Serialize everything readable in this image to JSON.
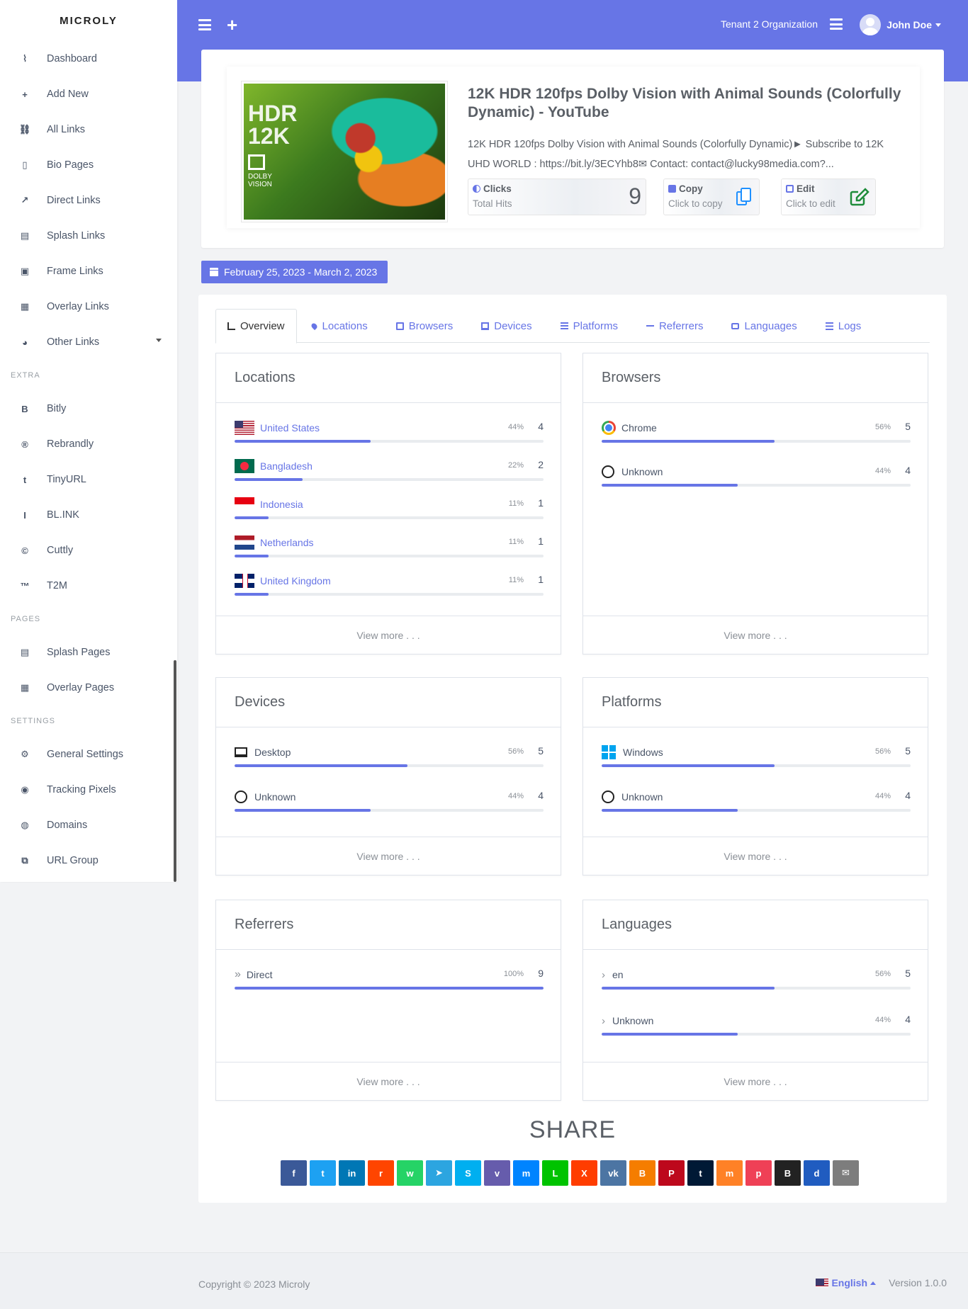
{
  "brand": "MICROLY",
  "sidebar": {
    "main": [
      {
        "label": "Dashboard",
        "icon": "chart-line-icon",
        "glyph": "⌇"
      },
      {
        "label": "Add New",
        "icon": "plus-icon",
        "glyph": "+"
      },
      {
        "label": "All Links",
        "icon": "link-icon",
        "glyph": "⛓"
      },
      {
        "label": "Bio Pages",
        "icon": "id-card-icon",
        "glyph": "▯"
      },
      {
        "label": "Direct Links",
        "icon": "external-link-icon",
        "glyph": "↗"
      },
      {
        "label": "Splash Links",
        "icon": "window-icon",
        "glyph": "▤"
      },
      {
        "label": "Frame Links",
        "icon": "frame-icon",
        "glyph": "▣"
      },
      {
        "label": "Overlay Links",
        "icon": "overlay-icon",
        "glyph": "▦"
      },
      {
        "label": "Other Links",
        "icon": "pie-chart-icon",
        "glyph": "◕"
      }
    ],
    "extra_title": "EXTRA",
    "extra": [
      {
        "label": "Bitly",
        "icon": "bitly-icon",
        "glyph": "B"
      },
      {
        "label": "Rebrandly",
        "icon": "rebrandly-icon",
        "glyph": "®"
      },
      {
        "label": "TinyURL",
        "icon": "tinyurl-icon",
        "glyph": "t"
      },
      {
        "label": "BL.INK",
        "icon": "blink-icon",
        "glyph": "I"
      },
      {
        "label": "Cuttly",
        "icon": "cuttly-icon",
        "glyph": "©"
      },
      {
        "label": "T2M",
        "icon": "trademark-icon",
        "glyph": "™"
      }
    ],
    "pages_title": "PAGES",
    "pages": [
      {
        "label": "Splash Pages",
        "icon": "window-icon",
        "glyph": "▤"
      },
      {
        "label": "Overlay Pages",
        "icon": "overlay-icon",
        "glyph": "▦"
      }
    ],
    "settings_title": "SETTINGS",
    "settings": [
      {
        "label": "General Settings",
        "icon": "gear-icon",
        "glyph": "⚙"
      },
      {
        "label": "Tracking Pixels",
        "icon": "target-icon",
        "glyph": "◉"
      },
      {
        "label": "Domains",
        "icon": "globe-icon",
        "glyph": "◍"
      },
      {
        "label": "URL Group",
        "icon": "group-icon",
        "glyph": "⧉"
      }
    ]
  },
  "header": {
    "organization": "Tenant 2 Organization",
    "user": "John Doe"
  },
  "link": {
    "title": "12K HDR 120fps Dolby Vision with Animal Sounds (Colorfully Dynamic) - YouTube",
    "description": "12K HDR 120fps Dolby Vision with Animal Sounds (Colorfully Dynamic)► Subscribe to 12K UHD WORLD : https://bit.ly/3ECYhb8✉ Contact: contact@lucky98media.com?...",
    "thumb_text_1": "HDR",
    "thumb_text_2": "12K",
    "thumb_text_3": "DOLBY VISION",
    "clicks_label": "Clicks",
    "clicks_sub": "Total Hits",
    "clicks_value": "9",
    "copy_label": "Copy",
    "copy_sub": "Click to copy",
    "edit_label": "Edit",
    "edit_sub": "Click to edit"
  },
  "date_range": "February 25, 2023 - March 2, 2023",
  "tabs": [
    {
      "label": "Overview",
      "icon": "chart-line-icon",
      "cls": "bars"
    },
    {
      "label": "Locations",
      "icon": "map-marker-icon",
      "cls": "pin"
    },
    {
      "label": "Browsers",
      "icon": "browser-icon",
      "cls": "win"
    },
    {
      "label": "Devices",
      "icon": "desktop-icon",
      "cls": "mon"
    },
    {
      "label": "Platforms",
      "icon": "server-icon",
      "cls": "stack"
    },
    {
      "label": "Referrers",
      "icon": "arrow-right-icon",
      "cls": "arrow"
    },
    {
      "label": "Languages",
      "icon": "language-icon",
      "cls": "card"
    },
    {
      "label": "Logs",
      "icon": "list-icon",
      "cls": "list"
    }
  ],
  "view_more": "View more . . .",
  "cards": {
    "locations": {
      "title": "Locations",
      "rows": [
        {
          "name": "United States",
          "pct": "44%",
          "count": "4",
          "fill": 0.44,
          "flag": "us"
        },
        {
          "name": "Bangladesh",
          "pct": "22%",
          "count": "2",
          "fill": 0.22,
          "flag": "bd"
        },
        {
          "name": "Indonesia",
          "pct": "11%",
          "count": "1",
          "fill": 0.11,
          "flag": "id"
        },
        {
          "name": "Netherlands",
          "pct": "11%",
          "count": "1",
          "fill": 0.11,
          "flag": "nl"
        },
        {
          "name": "United Kingdom",
          "pct": "11%",
          "count": "1",
          "fill": 0.11,
          "flag": "gb"
        }
      ]
    },
    "browsers": {
      "title": "Browsers",
      "rows": [
        {
          "name": "Chrome",
          "pct": "56%",
          "count": "5",
          "fill": 0.56,
          "icon": "chrome"
        },
        {
          "name": "Unknown",
          "pct": "44%",
          "count": "4",
          "fill": 0.44,
          "icon": "ring"
        }
      ]
    },
    "devices": {
      "title": "Devices",
      "rows": [
        {
          "name": "Desktop",
          "pct": "56%",
          "count": "5",
          "fill": 0.56,
          "icon": "desktop"
        },
        {
          "name": "Unknown",
          "pct": "44%",
          "count": "4",
          "fill": 0.44,
          "icon": "ring"
        }
      ]
    },
    "platforms": {
      "title": "Platforms",
      "rows": [
        {
          "name": "Windows",
          "pct": "56%",
          "count": "5",
          "fill": 0.56,
          "icon": "windows"
        },
        {
          "name": "Unknown",
          "pct": "44%",
          "count": "4",
          "fill": 0.44,
          "icon": "ring"
        }
      ]
    },
    "referrers": {
      "title": "Referrers",
      "rows": [
        {
          "name": "Direct",
          "pct": "100%",
          "count": "9",
          "fill": 1.0,
          "icon": "dblchev"
        }
      ]
    },
    "languages": {
      "title": "Languages",
      "rows": [
        {
          "name": "en",
          "pct": "56%",
          "count": "5",
          "fill": 0.56,
          "icon": "chev"
        },
        {
          "name": "Unknown",
          "pct": "44%",
          "count": "4",
          "fill": 0.44,
          "icon": "chev"
        }
      ]
    }
  },
  "share": {
    "title": "SHARE",
    "buttons": [
      {
        "name": "facebook",
        "color": "#3b5998",
        "glyph": "f"
      },
      {
        "name": "twitter",
        "color": "#1da1f2",
        "glyph": "t"
      },
      {
        "name": "linkedin",
        "color": "#0077b5",
        "glyph": "in"
      },
      {
        "name": "reddit",
        "color": "#ff4500",
        "glyph": "r"
      },
      {
        "name": "whatsapp",
        "color": "#25d366",
        "glyph": "w"
      },
      {
        "name": "telegram",
        "color": "#2ca5e0",
        "glyph": "➤"
      },
      {
        "name": "skype",
        "color": "#00aff0",
        "glyph": "S"
      },
      {
        "name": "viber",
        "color": "#665cac",
        "glyph": "v"
      },
      {
        "name": "messenger",
        "color": "#0084ff",
        "glyph": "m"
      },
      {
        "name": "line",
        "color": "#00c300",
        "glyph": "L"
      },
      {
        "name": "xing",
        "color": "#ff3d00",
        "glyph": "X"
      },
      {
        "name": "vk",
        "color": "#4c75a3",
        "glyph": "vk"
      },
      {
        "name": "blogger",
        "color": "#f57d00",
        "glyph": "B"
      },
      {
        "name": "pinterest",
        "color": "#bd081c",
        "glyph": "P"
      },
      {
        "name": "tumblr",
        "color": "#001935",
        "glyph": "t"
      },
      {
        "name": "mix",
        "color": "#ff8126",
        "glyph": "m"
      },
      {
        "name": "pocket",
        "color": "#ef4056",
        "glyph": "p"
      },
      {
        "name": "bootstrap",
        "color": "#222222",
        "glyph": "B"
      },
      {
        "name": "delicious",
        "color": "#205cc0",
        "glyph": "d"
      },
      {
        "name": "email",
        "color": "#7d7d7d",
        "glyph": "✉"
      }
    ]
  },
  "footer": {
    "copyright": "Copyright © 2023 Microly",
    "language": "English",
    "version": "Version 1.0.0"
  }
}
